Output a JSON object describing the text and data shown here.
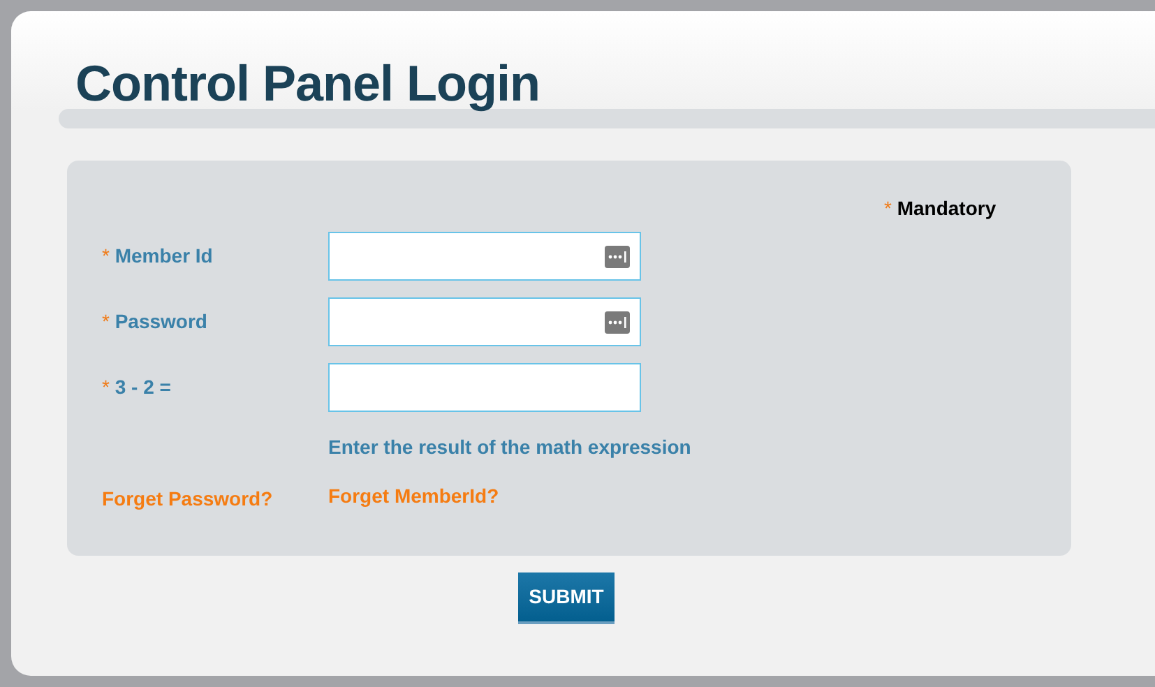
{
  "title": "Control Panel Login",
  "mandatory_note": {
    "mark": "*",
    "label": "Mandatory"
  },
  "fields": [
    {
      "mark": "*",
      "label": "Member Id",
      "kind": "autofill"
    },
    {
      "mark": "*",
      "label": "Password",
      "kind": "autofill"
    },
    {
      "mark": "*",
      "label": "3 - 2 =",
      "kind": "plain"
    }
  ],
  "hint": "Enter the result of the math expression",
  "links": [
    "Forget Password?",
    "Forget MemberId?"
  ],
  "submit": "SUBMIT"
}
